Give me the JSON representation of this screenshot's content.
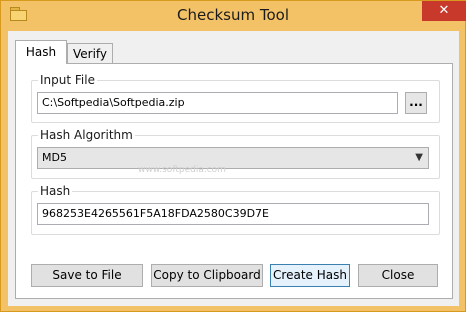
{
  "window": {
    "title": "Checksum Tool",
    "close_glyph": "✕"
  },
  "tabs": [
    {
      "label": "Hash",
      "active": true
    },
    {
      "label": "Verify",
      "active": false
    }
  ],
  "input_file": {
    "label": "Input File",
    "value": "C:\\Softpedia\\Softpedia.zip",
    "browse_label": "..."
  },
  "hash_algorithm": {
    "label": "Hash Algorithm",
    "selected": "MD5",
    "watermark": "www.softpedia.com"
  },
  "hash": {
    "label": "Hash",
    "value": "968253E4265561F5A18FDA2580C39D7E"
  },
  "buttons": {
    "save_to_file": "Save to File",
    "copy_to_clipboard": "Copy to Clipboard",
    "create_hash": "Create Hash",
    "close": "Close"
  },
  "icons": {
    "app": "folder-icon",
    "close": "close-icon",
    "dropdown": "chevron-down-icon"
  },
  "colors": {
    "title_bar": "#f4c266",
    "close_button": "#c8392c"
  }
}
